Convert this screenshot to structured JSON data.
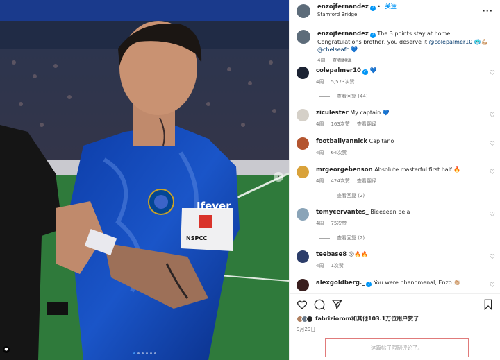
{
  "post": {
    "username": "enzojfernandez",
    "follow_label": "关注",
    "location": "Stamford Bridge",
    "more_label": "···",
    "photo_alt": "Chelsea player in blue jersey with captain armband",
    "sponsor_text": "Ifever",
    "badge_text": "NSPCC",
    "armband_text": "PLAY SAFE"
  },
  "caption": {
    "username": "enzojfernandez",
    "text": "The 3 points stay at home. Congratulations brother, you deserve it",
    "mention1": "@colepalmer10",
    "emoji": "🥶💪🏼",
    "mention2": "@chelseafc",
    "heart": "💙",
    "time": "4周",
    "translate": "查看翻译"
  },
  "comments": [
    {
      "username": "colepalmer10",
      "text": "💙",
      "time": "4周",
      "likes": "5,573次赞",
      "extra": "",
      "replies": "查看回复 (44)",
      "verified": true
    },
    {
      "username": "ziculester",
      "text": "My captain 💙",
      "time": "4周",
      "likes": "163次赞",
      "extra": "查看翻译",
      "replies": "",
      "verified": false
    },
    {
      "username": "footballyannick",
      "text": "Capitano",
      "time": "4周",
      "likes": "64次赞",
      "extra": "",
      "replies": "",
      "verified": false
    },
    {
      "username": "mrgeorgebenson",
      "text": "Absolute masterful first half 🔥",
      "time": "4周",
      "likes": "424次赞",
      "extra": "查看翻译",
      "replies": "查看回复 (2)",
      "verified": false
    },
    {
      "username": "tomycervantes_",
      "text": "Bieeeeen pela",
      "time": "4周",
      "likes": "75次赞",
      "extra": "",
      "replies": "查看回复 (2)",
      "verified": false
    },
    {
      "username": "teebase8",
      "text": "😮🔥🔥",
      "time": "4周",
      "likes": "1次赞",
      "extra": "",
      "replies": "",
      "verified": false
    },
    {
      "username": "alexgoldberg._",
      "text": "You were phenomenal, Enzo 👏🏼",
      "time": "",
      "likes": "",
      "extra": "",
      "replies": "",
      "verified": true
    }
  ],
  "likes_text": "fabriziorom和其他103.1万位用户赞了",
  "date": "9月29日",
  "comments_disabled": "这篇帖子限制评论了。",
  "icons": [
    "heart-icon",
    "comment-icon",
    "share-icon",
    "bookmark-icon",
    "chevron-right-icon"
  ],
  "colors": {
    "accent": "#0095f6",
    "chelsea_blue": "#034694",
    "pitch": "#2f7a3b"
  }
}
